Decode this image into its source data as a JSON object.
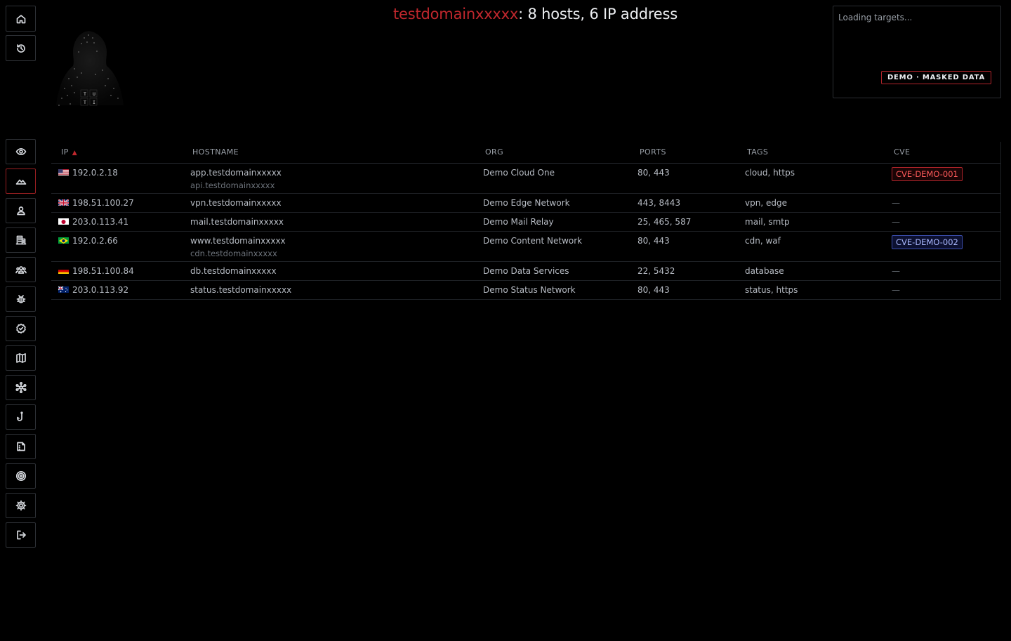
{
  "header": {
    "domain": "testdomainxxxxx",
    "summary": ": 8 hosts, 6 IP address"
  },
  "targets": {
    "loading": "Loading targets...",
    "badge": "DEMO · MASKED DATA"
  },
  "sidebar": {
    "top": [
      {
        "name": "home-icon"
      },
      {
        "name": "history-icon"
      }
    ],
    "items": [
      {
        "name": "eye-icon"
      },
      {
        "name": "mountain-icon",
        "active": true
      },
      {
        "name": "user-icon"
      },
      {
        "name": "building-icon"
      },
      {
        "name": "group-icon"
      },
      {
        "name": "bug-icon"
      },
      {
        "name": "check-badge-icon"
      },
      {
        "name": "map-icon"
      },
      {
        "name": "network-icon"
      },
      {
        "name": "fishhook-icon"
      },
      {
        "name": "document-icon"
      },
      {
        "name": "target-icon"
      },
      {
        "name": "settings-icon"
      },
      {
        "name": "logout-icon"
      }
    ]
  },
  "table": {
    "columns": [
      "IP",
      "HOSTNAME",
      "ORG",
      "PORTS",
      "TAGS",
      "CVE"
    ],
    "sort_indicator": "▲",
    "rows": [
      {
        "flag": "us",
        "ip": "192.0.2.18",
        "hostname": "app.testdomainxxxxx",
        "alias": "api.testdomainxxxxx",
        "org": "Demo Cloud One",
        "ports": "80, 443",
        "tags": "cloud, https",
        "cve": "CVE-DEMO-001",
        "cve_style": "red"
      },
      {
        "flag": "gb",
        "ip": "198.51.100.27",
        "hostname": "vpn.testdomainxxxxx",
        "alias": "",
        "org": "Demo Edge Network",
        "ports": "443, 8443",
        "tags": "vpn, edge",
        "cve": "—",
        "cve_style": "none"
      },
      {
        "flag": "jp",
        "ip": "203.0.113.41",
        "hostname": "mail.testdomainxxxxx",
        "alias": "",
        "org": "Demo Mail Relay",
        "ports": "25, 465, 587",
        "tags": "mail, smtp",
        "cve": "—",
        "cve_style": "none"
      },
      {
        "flag": "br",
        "ip": "192.0.2.66",
        "hostname": "www.testdomainxxxxx",
        "alias": "cdn.testdomainxxxxx",
        "org": "Demo Content Network",
        "ports": "80, 443",
        "tags": "cdn, waf",
        "cve": "CVE-DEMO-002",
        "cve_style": "blue"
      },
      {
        "flag": "de",
        "ip": "198.51.100.84",
        "hostname": "db.testdomainxxxxx",
        "alias": "",
        "org": "Demo Data Services",
        "ports": "22, 5432",
        "tags": "database",
        "cve": "—",
        "cve_style": "none"
      },
      {
        "flag": "au",
        "ip": "203.0.113.92",
        "hostname": "status.testdomainxxxxx",
        "alias": "",
        "org": "Demo Status Network",
        "ports": "80, 443",
        "tags": "status, https",
        "cve": "—",
        "cve_style": "none"
      }
    ]
  },
  "colors": {
    "accent_red": "#c0272d",
    "cve_red": "#ff5b5b",
    "cve_blue": "#aab9ff"
  }
}
